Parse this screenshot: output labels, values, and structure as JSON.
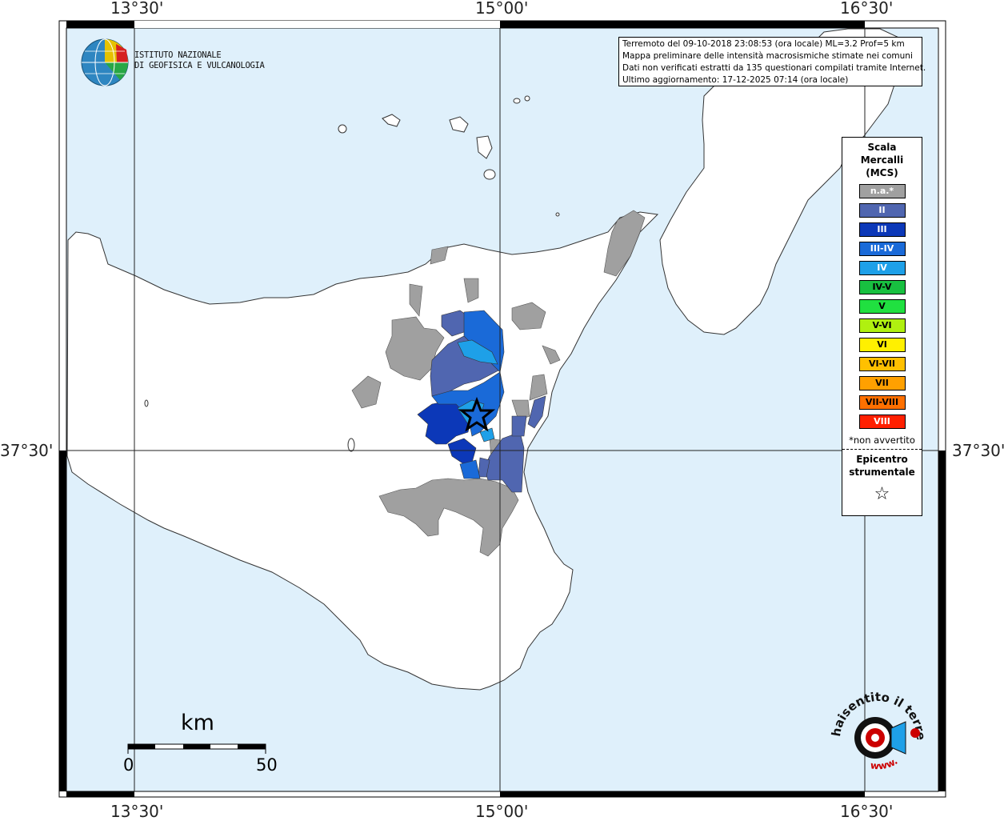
{
  "coordinates": {
    "top": [
      "13°30'",
      "15°00'",
      "16°30'"
    ],
    "bottom": [
      "13°30'",
      "15°00'",
      "16°30'"
    ],
    "left": [
      "37°30'"
    ],
    "right": [
      "37°30'"
    ]
  },
  "institute": {
    "line1": "ISTITUTO NAZIONALE",
    "line2": "DI GEOFISICA E VULCANOLOGIA"
  },
  "info": {
    "line1": "Terremoto del 09-10-2018 23:08:53 (ora locale) ML=3.2 Prof=5 km",
    "line2": "Mappa preliminare delle intensità macrosismiche stimate nei comuni",
    "line3": "Dati non verificati estratti da 135 questionari compilati tramite Internet.",
    "line4": "Ultimo aggiornamento: 17-12-2025 07:14 (ora locale)"
  },
  "legend": {
    "title_1": "Scala",
    "title_2": "Mercalli",
    "title_3": "(MCS)",
    "classes": [
      {
        "label": "n.a.*",
        "color": "#a0a0a0"
      },
      {
        "label": "II",
        "color": "#5066b0"
      },
      {
        "label": "III",
        "color": "#0c38b8"
      },
      {
        "label": "III-IV",
        "color": "#1a6ad8"
      },
      {
        "label": "IV",
        "color": "#1ea0e8"
      },
      {
        "label": "IV-V",
        "color": "#18c040"
      },
      {
        "label": "V",
        "color": "#20e040"
      },
      {
        "label": "V-VI",
        "color": "#b0f010"
      },
      {
        "label": "VI",
        "color": "#fff000"
      },
      {
        "label": "VI-VII",
        "color": "#ffc000"
      },
      {
        "label": "VII",
        "color": "#ffa000"
      },
      {
        "label": "VII-VIII",
        "color": "#ff7000"
      },
      {
        "label": "VIII",
        "color": "#ff2000"
      }
    ],
    "note": "*non avvertito",
    "epi_1": "Epicentro",
    "epi_2": "strumentale",
    "star": "☆"
  },
  "scale": {
    "unit": "km",
    "start": "0",
    "end": "50"
  },
  "colors": {
    "sea": "#dff0fb",
    "land": "#ffffff",
    "coast": "#333333",
    "na_gray": "#a0a0a0"
  },
  "badge": {
    "text": "haisentito il terremoto.it",
    "www": "www."
  }
}
